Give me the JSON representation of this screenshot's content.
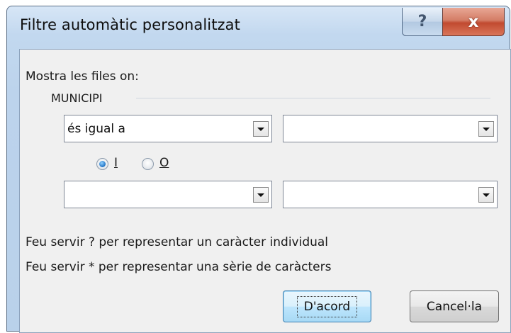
{
  "window": {
    "title": "Filtre automàtic personalitzat",
    "help_label": "?",
    "close_label": "x"
  },
  "dialog": {
    "intro": "Mostra les files on:",
    "field_name": "MUNICIPI",
    "criteria1": {
      "operator": "és igual a",
      "value": ""
    },
    "logic": {
      "and_label": "I",
      "or_label": "O",
      "selected": "I"
    },
    "criteria2": {
      "operator": "",
      "value": ""
    },
    "hint1": "Feu servir ? per representar un caràcter individual",
    "hint2": "Feu servir * per representar una sèrie de caràcters",
    "ok_label": "D'acord",
    "cancel_label": "Cancel·la"
  }
}
